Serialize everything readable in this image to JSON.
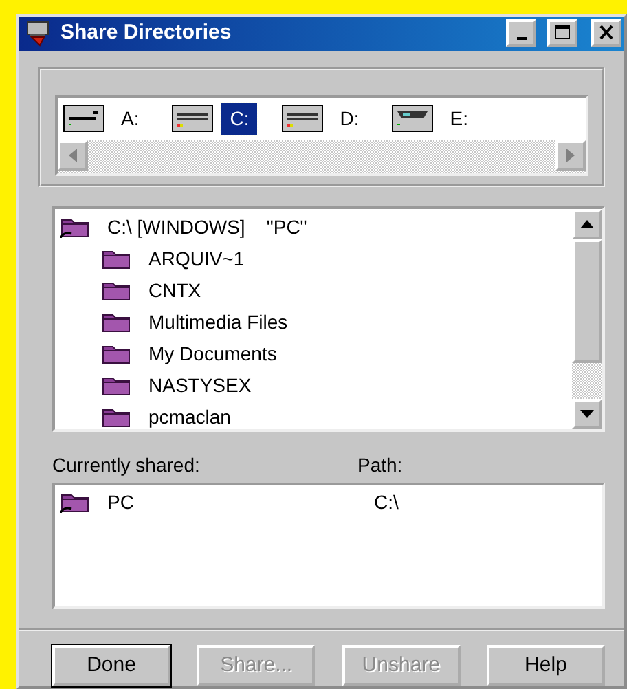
{
  "window": {
    "title": "Share Directories"
  },
  "drives": [
    {
      "kind": "floppy",
      "label": "A:",
      "selected": false
    },
    {
      "kind": "disk",
      "label": "C:",
      "selected": true
    },
    {
      "kind": "disk",
      "label": "D:",
      "selected": false
    },
    {
      "kind": "cdrom",
      "label": "E:",
      "selected": false
    }
  ],
  "tree": {
    "label": "C:\\ [WINDOWS]    \"PC\"",
    "shared": true,
    "children": [
      {
        "label": "ARQUIV~1"
      },
      {
        "label": "CNTX"
      },
      {
        "label": "Multimedia Files"
      },
      {
        "label": "My Documents"
      },
      {
        "label": "NASTYSEX"
      },
      {
        "label": "pcmaclan"
      }
    ]
  },
  "shared_list": {
    "columns": [
      "Currently shared:",
      "Path:"
    ],
    "rows": [
      {
        "name": "PC",
        "path": "C:\\"
      }
    ]
  },
  "buttons": [
    {
      "label": "Done",
      "disabled": false
    },
    {
      "label": "Share...",
      "disabled": true
    },
    {
      "label": "Unshare",
      "disabled": true
    },
    {
      "label": "Help",
      "disabled": false
    }
  ]
}
